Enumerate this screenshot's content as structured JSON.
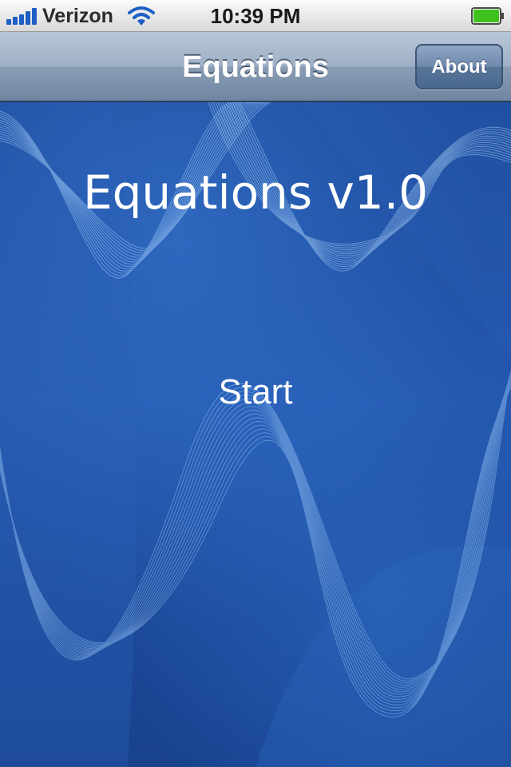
{
  "status_bar": {
    "carrier": "Verizon",
    "time": "10:39 PM",
    "signal_bars": 5,
    "battery_level": 1.0,
    "battery_color": "#3fc11d"
  },
  "nav_bar": {
    "title": "Equations",
    "right_button_label": "About"
  },
  "main": {
    "app_title": "Equations v1.0",
    "start_label": "Start"
  },
  "colors": {
    "background": "#1f4fa0",
    "accent": "#1d5fc4"
  }
}
